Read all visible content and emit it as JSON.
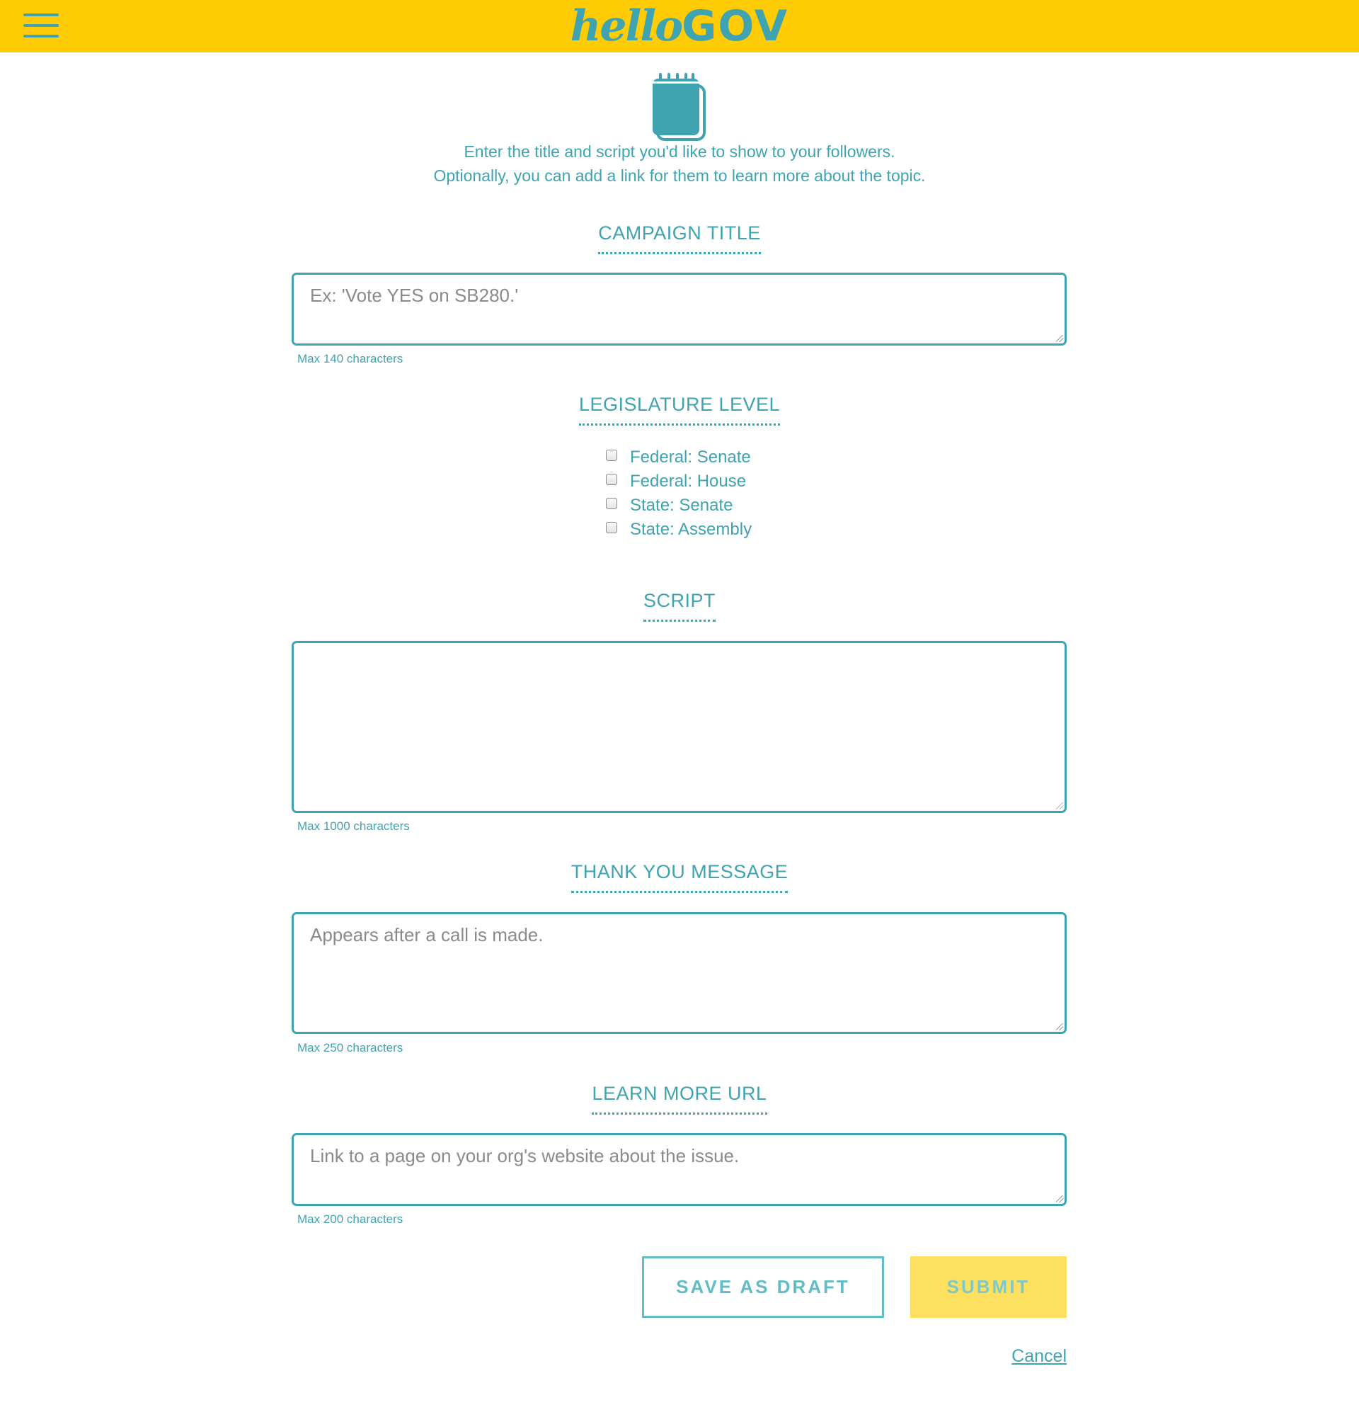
{
  "header": {
    "logo_part1": "hello",
    "logo_part2": "GOV",
    "menu_icon": "hamburger-menu-icon",
    "background_color": "#ffcc05",
    "accent_color": "#3fa3b0"
  },
  "intro": {
    "icon": "notepad-icon",
    "line1": "Enter the title and script you'd like to show to your followers.",
    "line2": "Optionally, you can add a link for them to learn more about the topic."
  },
  "campaign_title": {
    "label": "CAMPAIGN TITLE",
    "placeholder": "Ex: 'Vote YES on SB280.'",
    "value": "",
    "hint": "Max 140 characters"
  },
  "legislature_level": {
    "label": "LEGISLATURE LEVEL",
    "options": [
      {
        "label": "Federal: Senate",
        "checked": false
      },
      {
        "label": "Federal: House",
        "checked": false
      },
      {
        "label": "State: Senate",
        "checked": false
      },
      {
        "label": "State: Assembly",
        "checked": false
      }
    ]
  },
  "script": {
    "label": "SCRIPT",
    "placeholder": "",
    "value": "",
    "hint": "Max 1000 characters"
  },
  "thank_you": {
    "label": "THANK YOU MESSAGE",
    "placeholder": "Appears after a call is made.",
    "value": "",
    "hint": "Max 250 characters"
  },
  "learn_more": {
    "label": "LEARN MORE URL",
    "placeholder": "Link to a page on your org's website about the issue.",
    "value": "",
    "hint": "Max 200 characters"
  },
  "actions": {
    "save_draft": "SAVE AS DRAFT",
    "submit": "SUBMIT",
    "cancel": "Cancel"
  }
}
